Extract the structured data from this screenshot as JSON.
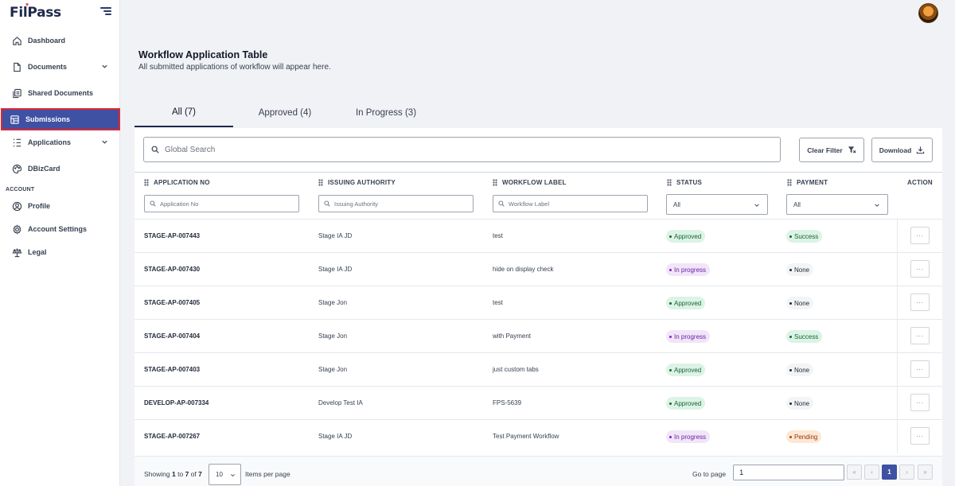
{
  "brand": {
    "name": "FilPass"
  },
  "sidebar": {
    "items": [
      {
        "label": "Dashboard",
        "icon": "home-icon",
        "has_chevron": false
      },
      {
        "label": "Documents",
        "icon": "document-icon",
        "has_chevron": true
      },
      {
        "label": "Shared Documents",
        "icon": "shared-documents-icon",
        "has_chevron": false
      },
      {
        "label": "Submissions",
        "icon": "submissions-icon",
        "has_chevron": false,
        "active": true
      },
      {
        "label": "Applications",
        "icon": "list-icon",
        "has_chevron": true
      },
      {
        "label": "DBizCard",
        "icon": "palette-icon",
        "has_chevron": false
      }
    ],
    "account_label": "ACCOUNT",
    "account_items": [
      {
        "label": "Profile",
        "icon": "user-icon"
      },
      {
        "label": "Account Settings",
        "icon": "gear-icon"
      },
      {
        "label": "Legal",
        "icon": "scale-icon"
      }
    ]
  },
  "header": {
    "title": "Workflow Application Table",
    "subtitle": "All submitted applications of workflow will appear here."
  },
  "tabs": [
    {
      "label": "All (7)",
      "active": true
    },
    {
      "label": "Approved (4)",
      "active": false
    },
    {
      "label": "In Progress (3)",
      "active": false
    }
  ],
  "toolbar": {
    "search_placeholder": "Global Search",
    "clear_filter_label": "Clear Filter",
    "download_label": "Download"
  },
  "table": {
    "columns": {
      "application_no": "APPLICATION NO",
      "issuing_authority": "ISSUING AUTHORITY",
      "workflow_label": "WORKFLOW LABEL",
      "status": "STATUS",
      "payment": "PAYMENT",
      "action": "ACTION"
    },
    "filters": {
      "application_no_placeholder": "Application No",
      "issuing_authority_placeholder": "Issuing Authority",
      "workflow_label_placeholder": "Workflow Label",
      "status_value": "All",
      "payment_value": "All"
    },
    "rows": [
      {
        "app_no": "STAGE-AP-007443",
        "authority": "Stage IA JD",
        "workflow": "test",
        "status": "Approved",
        "payment": "Success"
      },
      {
        "app_no": "STAGE-AP-007430",
        "authority": "Stage IA JD",
        "workflow": "hide on display check",
        "status": "In progress",
        "payment": "None"
      },
      {
        "app_no": "STAGE-AP-007405",
        "authority": "Stage Jon",
        "workflow": "test",
        "status": "Approved",
        "payment": "None"
      },
      {
        "app_no": "STAGE-AP-007404",
        "authority": "Stage Jon",
        "workflow": "with Payment",
        "status": "In progress",
        "payment": "Success"
      },
      {
        "app_no": "STAGE-AP-007403",
        "authority": "Stage Jon",
        "workflow": "just custom tabs",
        "status": "Approved",
        "payment": "None"
      },
      {
        "app_no": "DEVELOP-AP-007334",
        "authority": "Develop Test IA",
        "workflow": "FPS-5639",
        "status": "Approved",
        "payment": "None"
      },
      {
        "app_no": "STAGE-AP-007267",
        "authority": "Stage IA JD",
        "workflow": "Test Payment Workflow",
        "status": "In progress",
        "payment": "Pending"
      }
    ],
    "more_label": "···"
  },
  "pagination": {
    "showing_prefix": "Showing",
    "from": "1",
    "to_word": "to",
    "to": "7",
    "of_word": "of",
    "total": "7",
    "per_page": "10",
    "items_per_page_label": "Items per page",
    "go_to_label": "Go to page",
    "go_to_value": "1",
    "first": "«",
    "prev": "‹",
    "current": "1",
    "next": "›",
    "last": "»"
  },
  "colors": {
    "accent": "#3f51a3",
    "active_outline": "#e0262f",
    "approved_bg": "#dcf3e6",
    "progress_bg": "#f1e6f8",
    "pending_bg": "#fde8d4"
  }
}
